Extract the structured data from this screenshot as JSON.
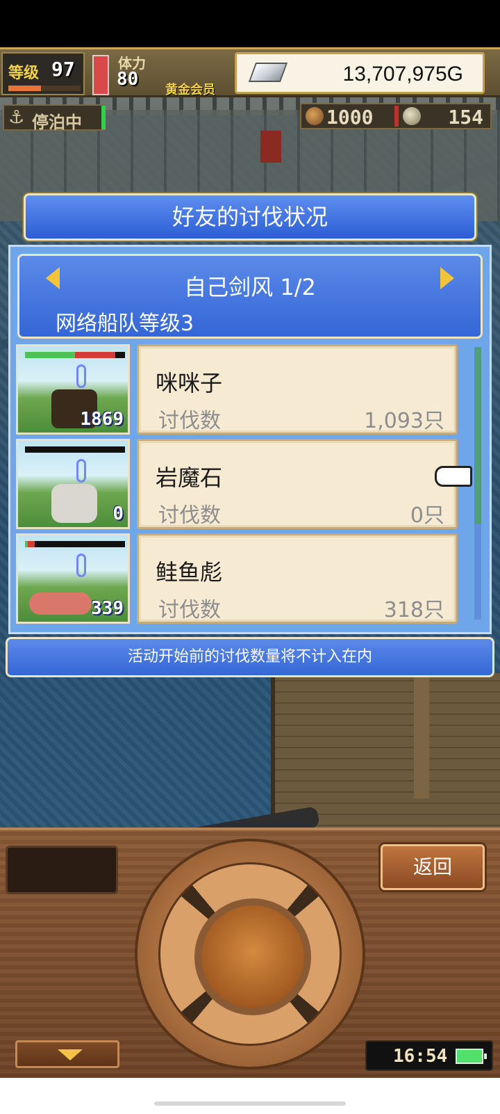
{
  "hud": {
    "level_label": "等级",
    "level_value": "97",
    "level_progress": 0.45,
    "stamina_label": "体力",
    "stamina_value": "80",
    "stamina_fill": 1.0,
    "member_label": "黄金会员",
    "money": "13,707,975G",
    "dock_status": "停泊中",
    "resource1_value": "1000",
    "resource2_value": "154"
  },
  "dialog": {
    "title": "好友的讨伐状况",
    "friend_name_page": "自己剑风 1/2",
    "fleet_level": "网络船队等级3",
    "kill_label": "讨伐数",
    "rows": [
      {
        "portrait_count": "1869",
        "name": "咪咪子",
        "kills": "1,093只",
        "hp": 0.5,
        "hp_lost": 0.4
      },
      {
        "portrait_count": "0",
        "name": "岩魔石",
        "kills": "0只",
        "hp": 0.0,
        "hp_lost": 0.0
      },
      {
        "portrait_count": "339",
        "name": "鲑鱼彪",
        "kills": "318只",
        "hp": 0.03,
        "hp_lost": 0.07
      }
    ],
    "notice": "活动开始前的讨伐数量将不计入在内"
  },
  "controls": {
    "back_label": "返回",
    "clock": "16:54"
  },
  "colors": {
    "accent_blue": "#3466d6",
    "gold": "#f2c43a",
    "card_bg": "#f6ead2"
  },
  "icons": [
    "anchor-icon",
    "silver-bar-icon",
    "arrow-left-icon",
    "arrow-right-icon",
    "pointer-hand-icon",
    "battery-icon",
    "down-arrow-icon"
  ]
}
